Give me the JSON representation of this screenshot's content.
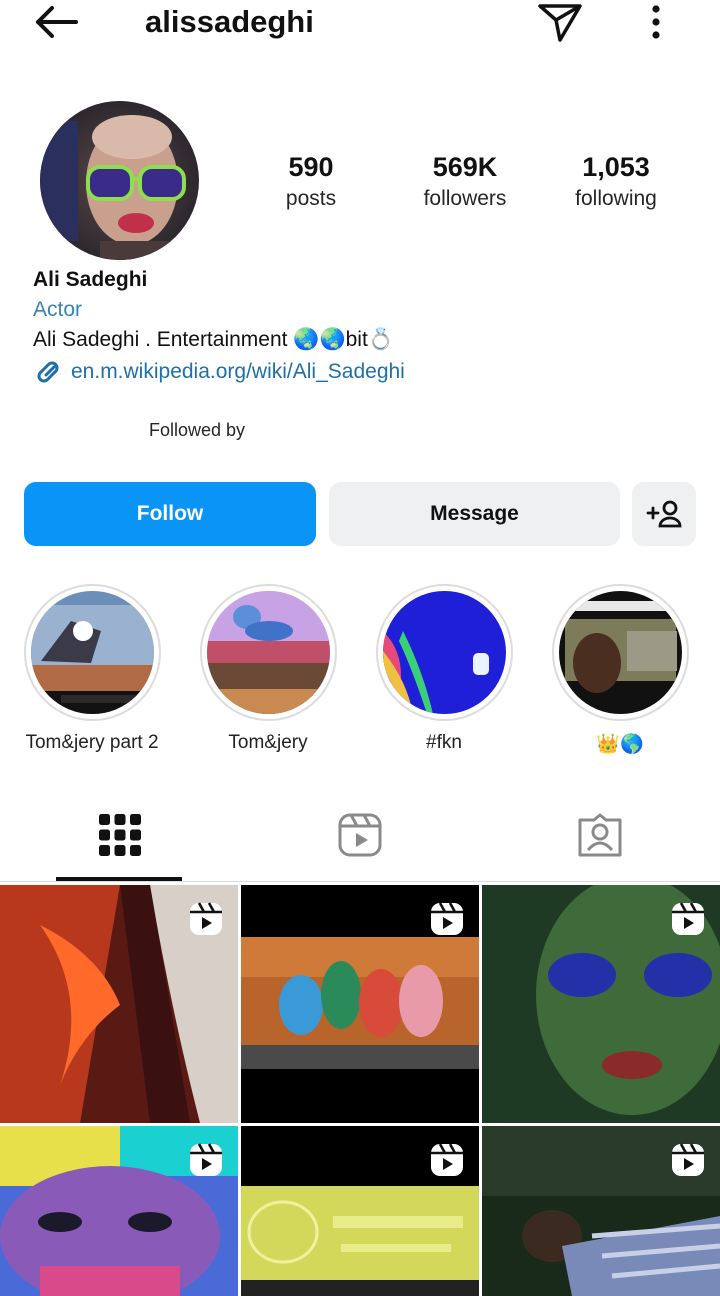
{
  "header": {
    "username": "alissadeghi",
    "icons": {
      "back": "arrow-left-icon",
      "send": "paper-plane-icon",
      "more": "vertical-dots-icon"
    }
  },
  "profile": {
    "stats": [
      {
        "value": "590",
        "label": "posts"
      },
      {
        "value": "569K",
        "label": "followers"
      },
      {
        "value": "1,053",
        "label": "following"
      }
    ],
    "name": "Ali Sadeghi",
    "category": "Actor",
    "bio": "Ali Sadeghi .  Entertainment 🌏🌏bit💍",
    "link": "en.m.wikipedia.org/wiki/Ali_Sadeghi",
    "followed_by": "Followed by"
  },
  "actions": {
    "follow": "Follow",
    "message": "Message",
    "add_user_icon": "add-person-icon"
  },
  "highlights": [
    {
      "label": "Tom&jery part 2"
    },
    {
      "label": "Tom&jery"
    },
    {
      "label": "#fkn"
    },
    {
      "label": "👑🌎"
    }
  ],
  "tabs": [
    {
      "name": "posts-grid",
      "icon": "grid-icon",
      "active": true
    },
    {
      "name": "reels",
      "icon": "reels-icon",
      "active": false
    },
    {
      "name": "tagged",
      "icon": "tagged-person-icon",
      "active": false
    }
  ],
  "posts": [
    {
      "type": "reel"
    },
    {
      "type": "reel"
    },
    {
      "type": "reel"
    },
    {
      "type": "reel"
    },
    {
      "type": "reel"
    },
    {
      "type": "reel"
    }
  ],
  "colors": {
    "accent": "#0a95f6",
    "link": "#1f6fa8",
    "category": "#3b82b6",
    "button_bg": "#eff0f2"
  }
}
